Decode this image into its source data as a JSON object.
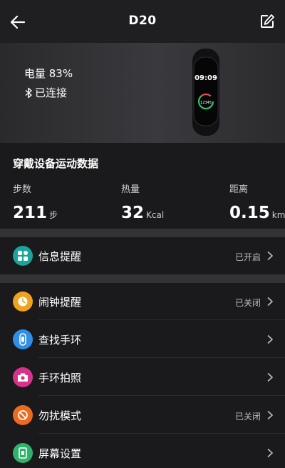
{
  "header": {
    "title": "D20",
    "back_icon": "arrow-left-icon",
    "edit_icon": "edit-icon"
  },
  "device": {
    "battery_text": "电量 83%",
    "connection_text": "已连接",
    "band_screen": {
      "time": "09:09",
      "steps": "12345"
    }
  },
  "stats": {
    "title": "穿戴设备运动数据",
    "items": [
      {
        "label": "步数",
        "value": "211",
        "unit": "步"
      },
      {
        "label": "热量",
        "value": "32",
        "unit": "Kcal"
      },
      {
        "label": "距离",
        "value": "0.15",
        "unit": "km"
      }
    ]
  },
  "menu": [
    {
      "label": "信息提醒",
      "status": "已开启",
      "icon": "apps-grid-icon",
      "color": "#1ba39c"
    },
    {
      "label": "闹钟提醒",
      "status": "已关闭",
      "icon": "clock-icon",
      "color": "#f0a21e"
    },
    {
      "label": "查找手环",
      "status": "",
      "icon": "band-icon",
      "color": "#2f8fe8"
    },
    {
      "label": "手环拍照",
      "status": "",
      "icon": "camera-icon",
      "color": "#d6338a"
    },
    {
      "label": "勿扰模式",
      "status": "已关闭",
      "icon": "no-disturb-icon",
      "color": "#ee6a1f"
    },
    {
      "label": "屏幕设置",
      "status": "",
      "icon": "screen-icon",
      "color": "#2fb36b"
    }
  ]
}
